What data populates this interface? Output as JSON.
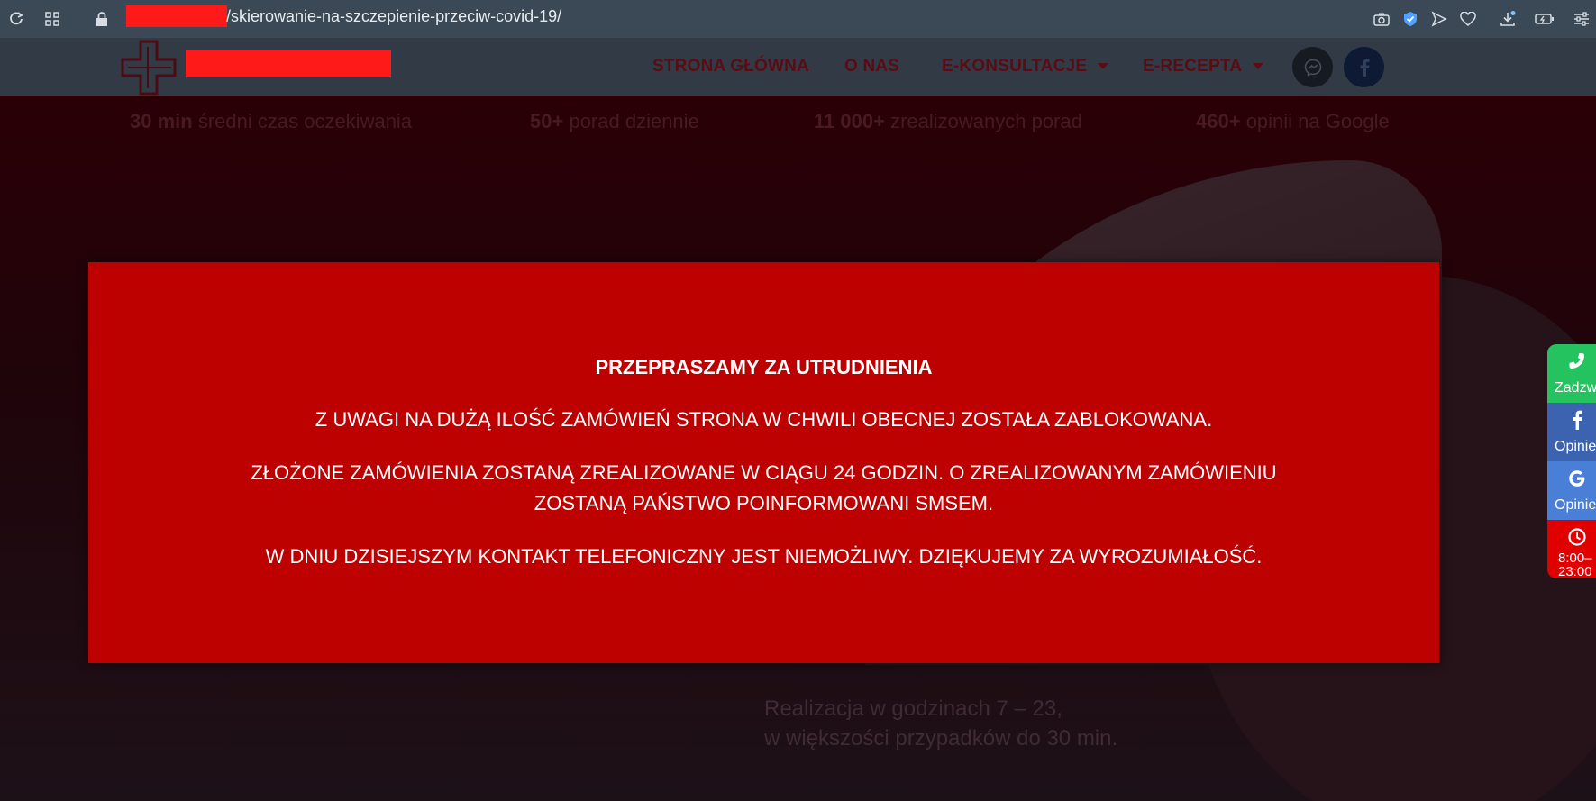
{
  "browser": {
    "url_path": "/skierowanie-na-szczepienie-przeciw-covid-19/"
  },
  "nav": {
    "items": [
      {
        "label": "STRONA GŁÓWNA"
      },
      {
        "label": "O NAS"
      },
      {
        "label": "E-KONSULTACJE"
      },
      {
        "label": "E-RECEPTA"
      }
    ]
  },
  "stats": [
    {
      "value": "30 min",
      "text": "średni czas oczekiwania"
    },
    {
      "value": "50+",
      "text": "porad dziennie"
    },
    {
      "value": "11 000+",
      "text": "zrealizowanych porad"
    },
    {
      "value": "460+",
      "text": "opinii na Google"
    }
  ],
  "hero": {
    "line1": "Realizacja w godzinach 7 – 23,",
    "line2": "w większości przypadków do 30 min."
  },
  "modal": {
    "title": "PRZEPRASZAMY ZA UTRUDNIENIA",
    "line1": "Z UWAGI NA DUŻĄ ILOŚĆ ZAMÓWIEŃ STRONA W CHWILI OBECNEJ ZOSTAŁA ZABLOKOWANA.",
    "line2a": "ZŁOŻONE ZAMÓWIENIA ZOSTANĄ ZREALIZOWANE W CIĄGU 24 GODZIN. O ZREALIZOWANYM ZAMÓWIENIU",
    "line2b": "ZOSTANĄ PAŃSTWO POINFORMOWANI SMSEM.",
    "line3": "W DNIU DZISIEJSZYM KONTAKT TELEFONICZNY JEST NIEMOŻLIWY. DZIĘKUJEMY ZA WYROZUMIAŁOŚĆ."
  },
  "side_widget": {
    "call_label": "Zadzw",
    "fb_label": "Opinie",
    "google_label": "Opinie",
    "hours_line1": "8:00–",
    "hours_line2": "23:00"
  },
  "colors": {
    "modal_bg": "#bd0000",
    "nav_text": "#5a0b13",
    "call": "#25c35f",
    "facebook": "#3b63b0",
    "google": "#4a7fd8",
    "hours": "#e00000",
    "redaction": "#ff1a1a"
  }
}
